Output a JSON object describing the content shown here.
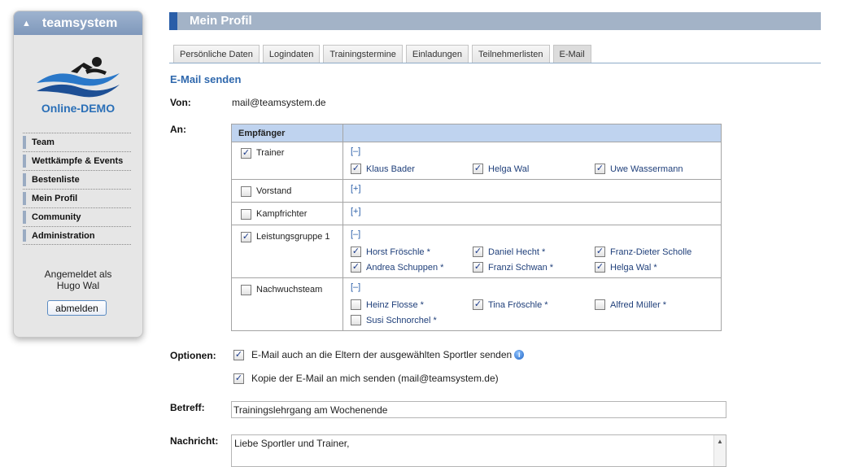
{
  "sidebar": {
    "brand": "teamsystem",
    "collapse_icon": "triangle-up-icon",
    "demo_label": "Online-DEMO",
    "nav": [
      {
        "label": "Team"
      },
      {
        "label": "Wettkämpfe & Events"
      },
      {
        "label": "Bestenliste"
      },
      {
        "label": "Mein Profil"
      },
      {
        "label": "Community"
      },
      {
        "label": "Administration"
      }
    ],
    "logged_in_line1": "Angemeldet als",
    "logged_in_line2": "Hugo Wal",
    "logout_label": "abmelden"
  },
  "page": {
    "title": "Mein Profil",
    "tabs": [
      {
        "label": "Persönliche Daten",
        "active": false
      },
      {
        "label": "Logindaten",
        "active": false
      },
      {
        "label": "Trainingstermine",
        "active": false
      },
      {
        "label": "Einladungen",
        "active": false
      },
      {
        "label": "Teilnehmerlisten",
        "active": false
      },
      {
        "label": "E-Mail",
        "active": true
      }
    ]
  },
  "email": {
    "section_title": "E-Mail senden",
    "from_label": "Von:",
    "from_value": "mail@teamsystem.de",
    "to_label": "An:",
    "table_header": "Empfänger",
    "groups": [
      {
        "name": "Trainer",
        "checked": true,
        "toggle": "[–]",
        "members": [
          {
            "name": "Klaus Bader",
            "checked": true
          },
          {
            "name": "Helga Wal",
            "checked": true
          },
          {
            "name": "Uwe Wassermann",
            "checked": true
          }
        ]
      },
      {
        "name": "Vorstand",
        "checked": false,
        "toggle": "[+]",
        "members": []
      },
      {
        "name": "Kampfrichter",
        "checked": false,
        "toggle": "[+]",
        "members": []
      },
      {
        "name": "Leistungsgruppe 1",
        "checked": true,
        "toggle": "[–]",
        "members": [
          {
            "name": "Horst Fröschle *",
            "checked": true
          },
          {
            "name": "Daniel Hecht *",
            "checked": true
          },
          {
            "name": "Franz-Dieter Scholle",
            "checked": true
          },
          {
            "name": "Andrea Schuppen *",
            "checked": true
          },
          {
            "name": "Franzi Schwan *",
            "checked": true
          },
          {
            "name": "Helga Wal *",
            "checked": true
          }
        ]
      },
      {
        "name": "Nachwuchsteam",
        "checked": false,
        "toggle": "[–]",
        "members": [
          {
            "name": "Heinz Flosse *",
            "checked": false
          },
          {
            "name": "Tina Fröschle *",
            "checked": true
          },
          {
            "name": "Alfred Müller *",
            "checked": false
          },
          {
            "name": "Susi Schnorchel *",
            "checked": false
          }
        ]
      }
    ],
    "options_label": "Optionen:",
    "option_parents": "E-Mail auch an die Eltern der ausgewählten Sportler senden",
    "option_parents_checked": true,
    "option_copy": "Kopie der E-Mail an mich senden (mail@teamsystem.de)",
    "option_copy_checked": true,
    "subject_label": "Betreff:",
    "subject_value": "Trainingslehrgang am Wochenende",
    "message_label": "Nachricht:",
    "message_value": "Liebe Sportler und Trainer,"
  },
  "colors": {
    "accent": "#2a5ea8",
    "title_bar": "#a3b3c7",
    "table_header": "#bfd3ef",
    "link": "#2f68ad"
  }
}
